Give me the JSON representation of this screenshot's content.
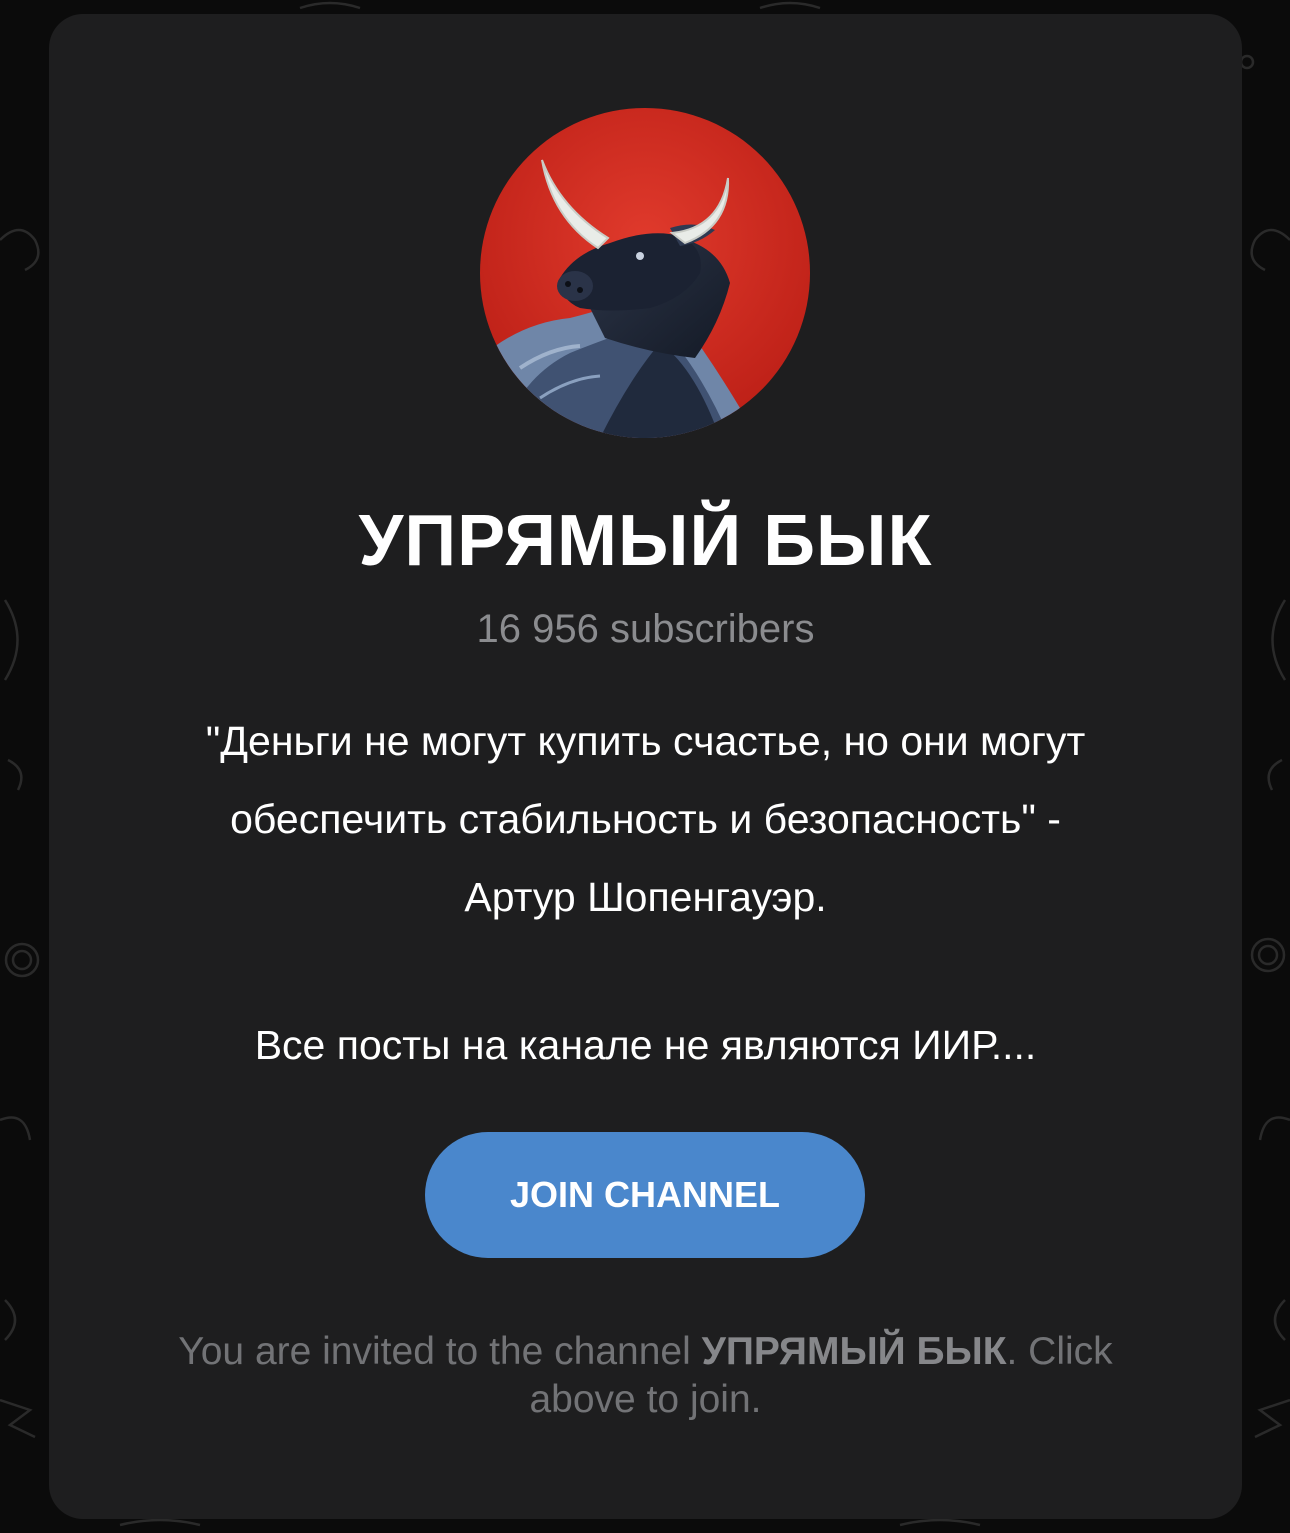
{
  "channel": {
    "title": "УПРЯМЫЙ БЫК",
    "subscribers": "16 956 subscribers",
    "avatar_description": "bull-painting-avatar",
    "description": {
      "quote": "\"Деньги не могут купить счастье, но они могут\nобеспечить стабильность и безопасность\" -\nАртур Шопенгауэр.",
      "notice": "Все посты на канале не являются ИИР...."
    }
  },
  "actions": {
    "join_label": "JOIN CHANNEL"
  },
  "invite": {
    "prefix": "You are invited to the channel ",
    "channel_name": "УПРЯМЫЙ БЫК",
    "suffix": ". Click above to join."
  },
  "colors": {
    "card_bg": "#1e1e1f",
    "page_bg": "#0b0b0b",
    "accent": "#4a87cc",
    "muted_text": "#8b8c8f",
    "avatar_red": "#d62a20"
  }
}
